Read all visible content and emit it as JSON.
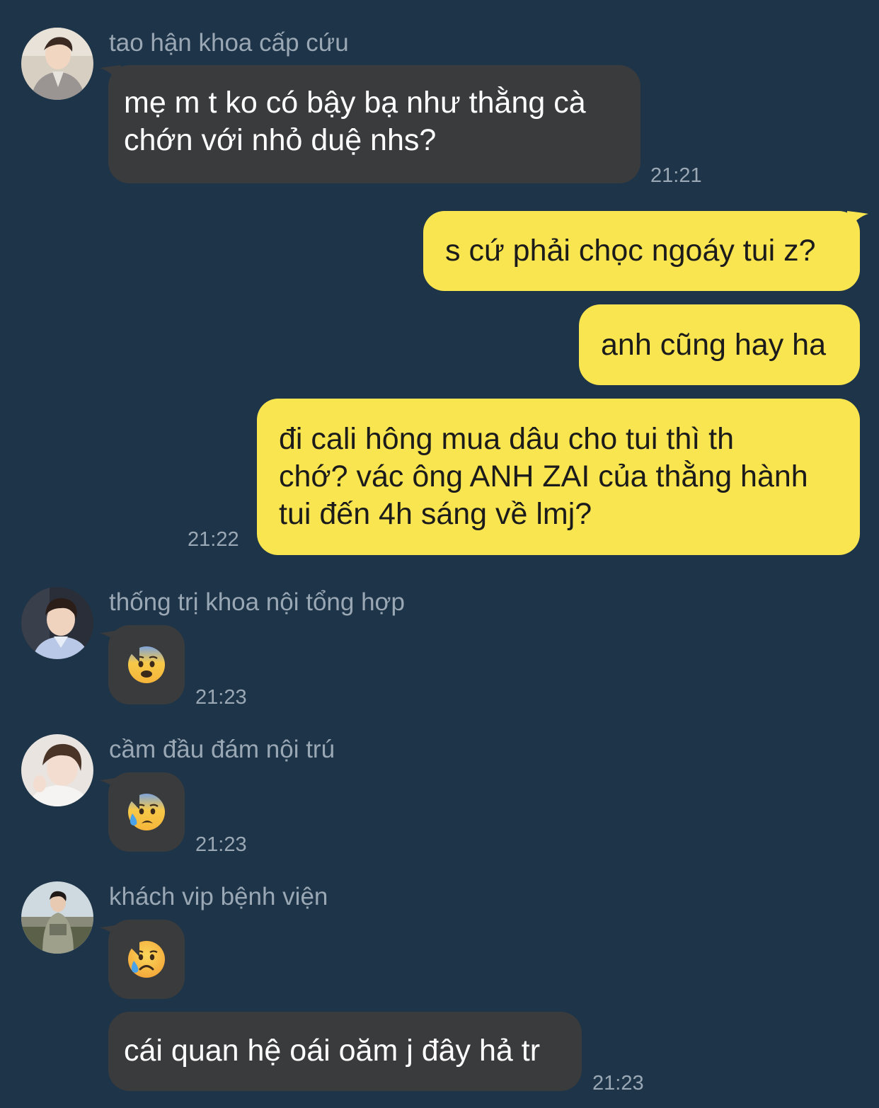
{
  "messages": [
    {
      "sender": "tao hận khoa cấp cứu",
      "lines": [
        "mẹ m t ko có bậy bạ như thằng cà",
        "chớn với nhỏ duệ nhs?"
      ],
      "time": "21:21"
    },
    {
      "lines": [
        "s cứ phải chọc ngoáy tui z?"
      ]
    },
    {
      "lines": [
        "anh cũng hay ha"
      ]
    },
    {
      "lines": [
        "đi cali hông mua dâu cho tui thì th",
        "chớ? vác ông ANH ZAI của thằng hành",
        "tui đến 4h sáng về lmj?"
      ],
      "time": "21:22"
    },
    {
      "sender": "thống trị khoa nội tổng hợp",
      "emoji": "fearful-face",
      "time": "21:23"
    },
    {
      "sender": "cầm đầu đám nội trú",
      "emoji": "anxious-face-with-sweat",
      "time": "21:23"
    },
    {
      "sender": "khách vip bệnh viện",
      "emoji": "sad-but-relieved-face",
      "time": null
    },
    {
      "lines": [
        "cái quan hệ oái oăm j đây hả tr"
      ],
      "time": "21:23"
    }
  ],
  "colors": {
    "background": "#1e3448",
    "incoming_bubble": "#3a3b3d",
    "outgoing_bubble": "#f9e54f",
    "meta_text": "#9aa7b4"
  }
}
